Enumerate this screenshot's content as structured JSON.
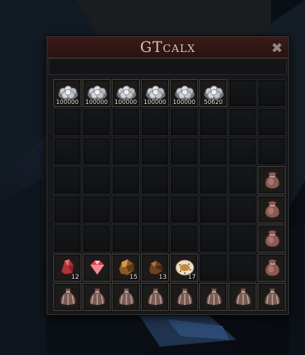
{
  "window": {
    "title": "GTcalx",
    "close_glyph": "✖"
  },
  "inventory": {
    "slots": [
      {
        "item": "silver-coins-icon",
        "qty": "100000"
      },
      {
        "item": "silver-coins-icon",
        "qty": "100000"
      },
      {
        "item": "silver-coins-icon",
        "qty": "100000"
      },
      {
        "item": "silver-coins-icon",
        "qty": "100000"
      },
      {
        "item": "silver-coins-icon",
        "qty": "100000"
      },
      {
        "item": "silver-coins-icon",
        "qty": "50620"
      },
      {
        "item": null
      },
      {
        "item": null
      },
      {
        "item": null
      },
      {
        "item": null
      },
      {
        "item": null
      },
      {
        "item": null
      },
      {
        "item": null
      },
      {
        "item": null
      },
      {
        "item": null
      },
      {
        "item": null
      },
      {
        "item": null
      },
      {
        "item": null
      },
      {
        "item": null
      },
      {
        "item": null
      },
      {
        "item": null
      },
      {
        "item": null
      },
      {
        "item": null
      },
      {
        "item": null
      },
      {
        "item": null
      },
      {
        "item": null
      },
      {
        "item": null
      },
      {
        "item": null
      },
      {
        "item": null
      },
      {
        "item": null
      },
      {
        "item": null
      },
      {
        "item": "pouch-icon",
        "qty": ""
      },
      {
        "item": null
      },
      {
        "item": null
      },
      {
        "item": null
      },
      {
        "item": null
      },
      {
        "item": null
      },
      {
        "item": null
      },
      {
        "item": null
      },
      {
        "item": "pouch-icon",
        "qty": ""
      },
      {
        "item": null
      },
      {
        "item": null
      },
      {
        "item": null
      },
      {
        "item": null
      },
      {
        "item": null
      },
      {
        "item": null
      },
      {
        "item": null
      },
      {
        "item": "pouch-icon",
        "qty": ""
      },
      {
        "item": "red-crystal-icon",
        "qty": "12"
      },
      {
        "item": "ruby-gem-icon",
        "qty": ""
      },
      {
        "item": "amber-ore-icon",
        "qty": "15"
      },
      {
        "item": "copper-ore-icon",
        "qty": "13"
      },
      {
        "item": "speckled-geode-icon",
        "qty": "17"
      },
      {
        "item": null
      },
      {
        "item": null
      },
      {
        "item": "pouch-icon",
        "qty": ""
      },
      {
        "item": "drawstring-bag-icon",
        "qty": ""
      },
      {
        "item": "drawstring-bag-icon",
        "qty": ""
      },
      {
        "item": "drawstring-bag-icon",
        "qty": ""
      },
      {
        "item": "drawstring-bag-icon",
        "qty": ""
      },
      {
        "item": "drawstring-bag-icon",
        "qty": ""
      },
      {
        "item": "drawstring-bag-icon",
        "qty": ""
      },
      {
        "item": "drawstring-bag-icon",
        "qty": ""
      },
      {
        "item": "drawstring-bag-icon",
        "qty": ""
      }
    ]
  },
  "colors": {
    "title_bar": "#3b1a19",
    "title_text": "#d6c7b8",
    "slot_border": "#26282b"
  }
}
